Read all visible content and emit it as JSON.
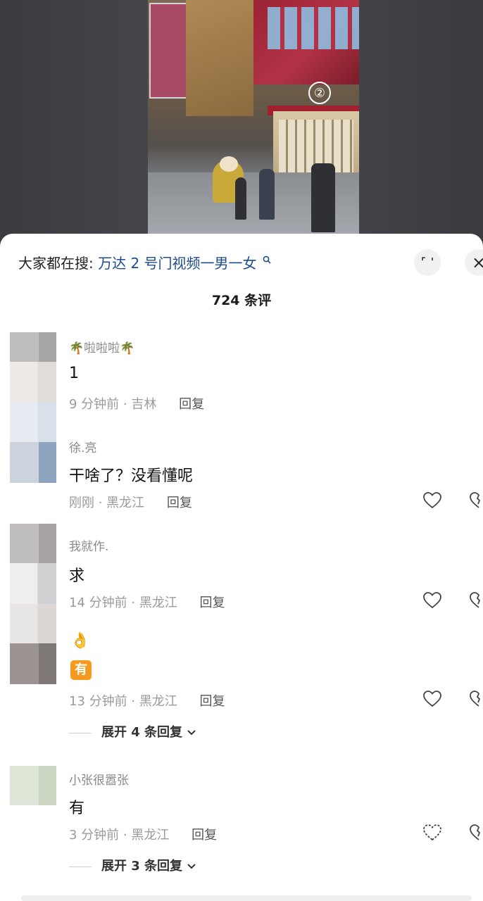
{
  "search": {
    "prefix": "大家都在搜:",
    "term": "万达 2 号门视频一男一女"
  },
  "comment_count": "724 条评",
  "comments": [
    {
      "user": "🌴啦啦啦🌴",
      "text": "1",
      "time": "9 分钟前",
      "location": "吉林",
      "reply": "回复"
    },
    {
      "user": "徐.亮",
      "text": "干啥了？没看懂呢",
      "time": "刚刚",
      "location": "黑龙江",
      "reply": "回复"
    },
    {
      "user": "我就作.",
      "text": "求",
      "time": "14 分钟前",
      "location": "黑龙江",
      "reply": "回复"
    },
    {
      "emoji1": "👌",
      "emoji2": "有",
      "time": "13 分钟前",
      "location": "黑龙江",
      "reply": "回复",
      "expand": "展开 4 条回复"
    },
    {
      "user": "小张很嚣张",
      "text": "有",
      "time": "3 分钟前",
      "location": "黑龙江",
      "reply": "回复",
      "expand": "展开 3 条回复"
    }
  ],
  "colors": {
    "search_term": "#1c4b8f",
    "sheet_bg": "#ffffff",
    "video_bg": "#45464a"
  }
}
